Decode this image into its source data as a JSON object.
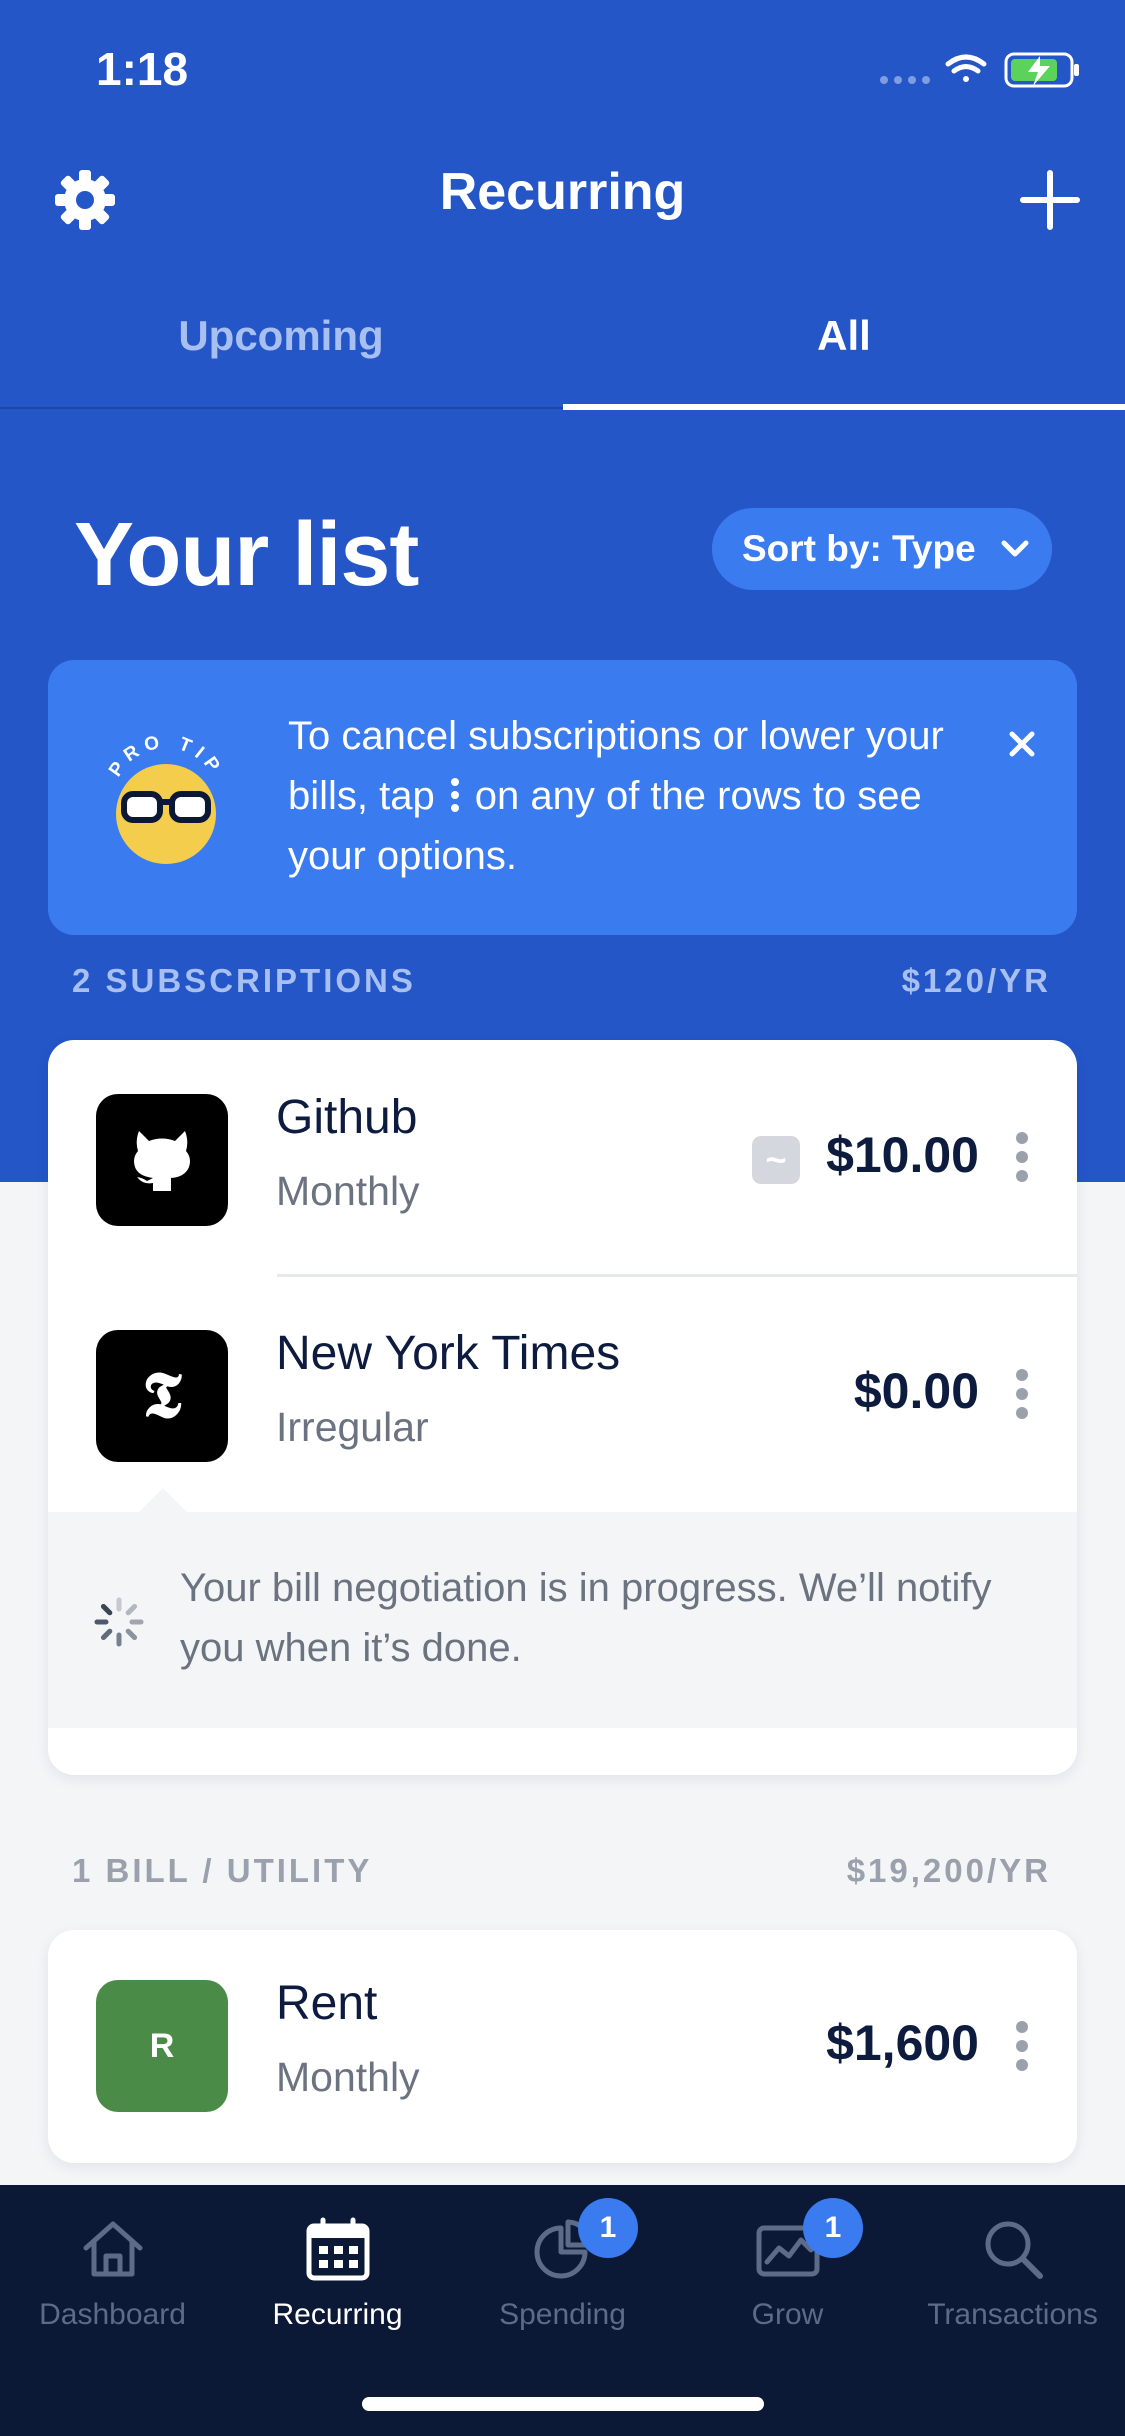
{
  "status_bar": {
    "time": "1:18"
  },
  "header": {
    "title": "Recurring"
  },
  "tabs": [
    {
      "label": "Upcoming",
      "active": false
    },
    {
      "label": "All",
      "active": true
    }
  ],
  "list": {
    "title": "Your list",
    "sort_label": "Sort by: Type"
  },
  "pro_tip": {
    "badge_text": "PRO TIP",
    "text_before": "To cancel subscriptions or lower your bills, tap",
    "text_after": "on any of the rows to see your options."
  },
  "sections": [
    {
      "label": "2 SUBSCRIPTIONS",
      "total": "$120/YR",
      "items": [
        {
          "name": "Github",
          "frequency": "Monthly",
          "amount": "$10.00",
          "approx_badge": "~"
        },
        {
          "name": "New York Times",
          "frequency": "Irregular",
          "amount": "$0.00",
          "logo_letter": "𝕿"
        }
      ],
      "negotiation_note": "Your bill negotiation is in progress. We’ll notify you when it’s done."
    },
    {
      "label": "1 BILL / UTILITY",
      "total": "$19,200/YR",
      "items": [
        {
          "name": "Rent",
          "frequency": "Monthly",
          "amount": "$1,600",
          "logo_letter": "R"
        }
      ]
    }
  ],
  "nav": [
    {
      "label": "Dashboard",
      "icon": "home-icon",
      "active": false
    },
    {
      "label": "Recurring",
      "icon": "calendar-icon",
      "active": true
    },
    {
      "label": "Spending",
      "icon": "pie-chart-icon",
      "active": false,
      "badge": "1"
    },
    {
      "label": "Grow",
      "icon": "growth-chart-icon",
      "active": false,
      "badge": "1"
    },
    {
      "label": "Transactions",
      "icon": "search-icon",
      "active": false
    }
  ],
  "colors": {
    "primary_blue": "#2456c8",
    "accent_blue": "#3a7bf0",
    "tabbar": "#0b1836",
    "rent_logo": "#4a8c47"
  }
}
